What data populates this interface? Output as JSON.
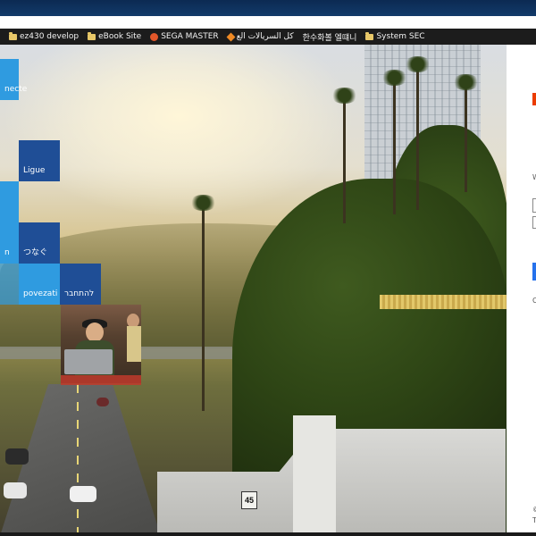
{
  "bookmarks": [
    {
      "label": "ez430 develop",
      "icon": "folder-icon"
    },
    {
      "label": "eBook Site",
      "icon": "folder-icon"
    },
    {
      "label": "SEGA MASTER",
      "icon": "sega-icon"
    },
    {
      "label": "كل السريالات الع",
      "icon": "diamond-icon"
    },
    {
      "label": "한수화볼 엘떄니",
      "icon": ""
    },
    {
      "label": "System SEC",
      "icon": "folder-icon"
    }
  ],
  "tiles": {
    "connecte": "necte",
    "ligue": "Ligue",
    "n": "n",
    "tsunagu": "つなぐ",
    "povezati": "povezati",
    "hebrew": "להתחבר"
  },
  "scene": {
    "speed_sign": "45"
  },
  "panel": {
    "w_label": "W",
    "small_label": "C",
    "footer_a": "©",
    "footer_b": "T"
  },
  "colors": {
    "tile_blue": "#1f4e96",
    "tile_sky": "#2f9be0",
    "accent_orange": "#eb3c00",
    "signin_blue": "#2672ec"
  }
}
